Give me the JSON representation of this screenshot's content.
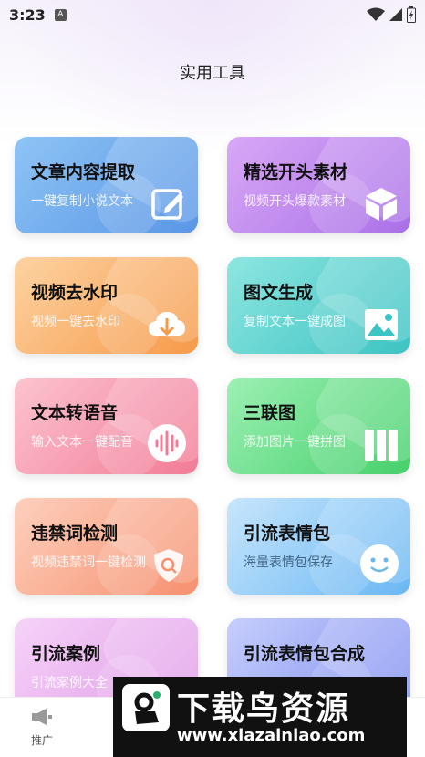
{
  "status_bar": {
    "time": "3:23",
    "notification_letter": "A"
  },
  "page": {
    "title": "实用工具"
  },
  "tools": [
    {
      "title": "文章内容提取",
      "subtitle": "一键复制小说文本",
      "icon": "edit-icon"
    },
    {
      "title": "精选开头素材",
      "subtitle": "视频开头爆款素材",
      "icon": "cube-icon"
    },
    {
      "title": "视频去水印",
      "subtitle": "视频一键去水印",
      "icon": "cloud-download-icon"
    },
    {
      "title": "图文生成",
      "subtitle": "复制文本一键成图",
      "icon": "image-icon"
    },
    {
      "title": "文本转语音",
      "subtitle": "输入文本一键配音",
      "icon": "audio-wave-icon"
    },
    {
      "title": "三联图",
      "subtitle": "添加图片一键拼图",
      "icon": "triptych-icon"
    },
    {
      "title": "违禁词检测",
      "subtitle": "视频违禁词一键检测",
      "icon": "shield-search-icon"
    },
    {
      "title": "引流表情包",
      "subtitle": "海量表情包保存",
      "icon": "smiley-icon"
    },
    {
      "title": "引流案例",
      "subtitle": "引流案例大全",
      "icon": "case-icon"
    },
    {
      "title": "引流表情包合成",
      "subtitle": "",
      "icon": "compose-icon"
    }
  ],
  "bottom_nav": {
    "items": [
      {
        "label": "推广",
        "icon": "megaphone-icon"
      }
    ]
  },
  "watermark": {
    "brand": "下载鸟资源",
    "url": "www.xiazainiao.com"
  }
}
